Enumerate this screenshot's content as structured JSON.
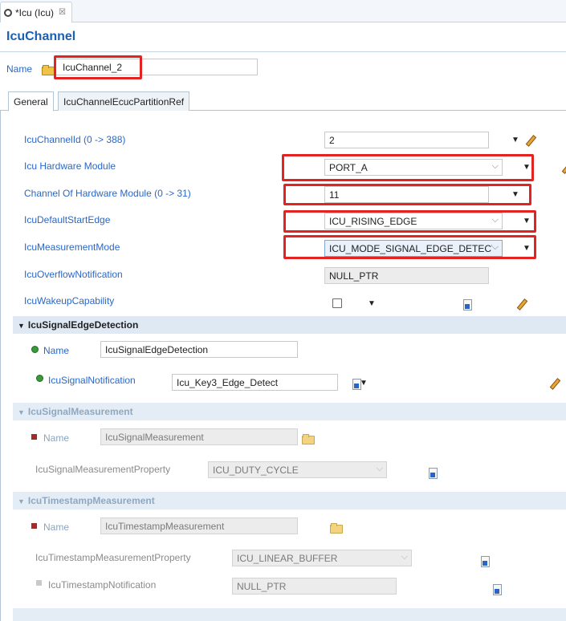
{
  "editor_tab": {
    "label": "*Icu (Icu)",
    "close": "☒"
  },
  "form": {
    "title": "IcuChannel"
  },
  "name_row": {
    "label": "Name",
    "value": "IcuChannel_2"
  },
  "subtabs": [
    {
      "label": "General"
    },
    {
      "label": "IcuChannelEcucPartitionRef"
    }
  ],
  "params": {
    "channel_id": {
      "label": "IcuChannelId (0 -> 388)",
      "value": "2"
    },
    "hw_module": {
      "label": "Icu Hardware Module",
      "value": "PORT_A"
    },
    "hw_channel": {
      "label": "Channel Of Hardware Module (0 -> 31)",
      "value": "11"
    },
    "start_edge": {
      "label": "IcuDefaultStartEdge",
      "value": "ICU_RISING_EDGE"
    },
    "measure_mode": {
      "label": "IcuMeasurementMode",
      "value": "ICU_MODE_SIGNAL_EDGE_DETECT"
    },
    "overflow": {
      "label": "IcuOverflowNotification",
      "value": "NULL_PTR"
    },
    "wakeup": {
      "label": "IcuWakeupCapability",
      "checked": false
    }
  },
  "edge_detection": {
    "header": "IcuSignalEdgeDetection",
    "name_label": "Name",
    "name_value": "IcuSignalEdgeDetection",
    "notif_label": "IcuSignalNotification",
    "notif_value": "Icu_Key3_Edge_Detect"
  },
  "signal_measurement": {
    "header": "IcuSignalMeasurement",
    "name_label": "Name",
    "name_value": "IcuSignalMeasurement",
    "prop_label": "IcuSignalMeasurementProperty",
    "prop_value": "ICU_DUTY_CYCLE"
  },
  "timestamp_measurement": {
    "header": "IcuTimestampMeasurement",
    "name_label": "Name",
    "name_value": "IcuTimestampMeasurement",
    "prop_label": "IcuTimestampMeasurementProperty",
    "prop_value": "ICU_LINEAR_BUFFER",
    "notif_label": "IcuTimestampNotification",
    "notif_value": "NULL_PTR"
  },
  "colors": {
    "highlight": "#e32222",
    "label_blue": "#2a67c8",
    "section_bg": "#dfe9f4"
  }
}
